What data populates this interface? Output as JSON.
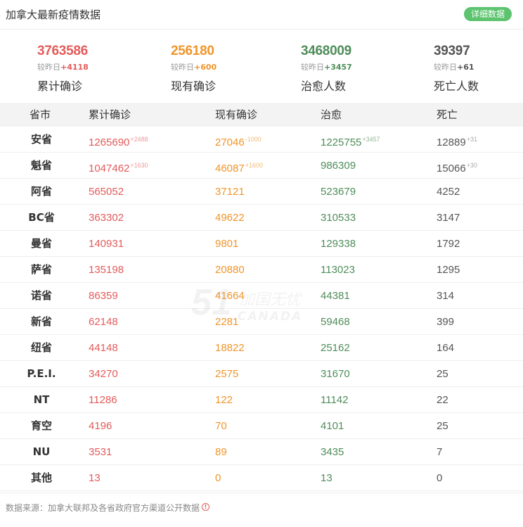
{
  "header": {
    "title": "加拿大最新疫情数据",
    "detail_button": "详细数据"
  },
  "summary": [
    {
      "value": "3763586",
      "delta_label": "较昨日",
      "delta": "+4118",
      "label": "累计确诊",
      "color": "#e45b5b"
    },
    {
      "value": "256180",
      "delta_label": "较昨日",
      "delta": "+600",
      "label": "现有确诊",
      "color": "#f0952a"
    },
    {
      "value": "3468009",
      "delta_label": "较昨日",
      "delta": "+3457",
      "label": "治愈人数",
      "color": "#4f8d5a"
    },
    {
      "value": "39397",
      "delta_label": "较昨日",
      "delta": "+61",
      "label": "死亡人数",
      "color": "#555555"
    }
  ],
  "table": {
    "headers": [
      "省市",
      "累计确诊",
      "现有确诊",
      "治愈",
      "死亡"
    ],
    "rows": [
      {
        "prov": "安省",
        "total": "1265690",
        "total_d": "+2488",
        "active": "27046",
        "active_d": "-1000",
        "cured": "1225755",
        "cured_d": "+3457",
        "dead": "12889",
        "dead_d": "+31"
      },
      {
        "prov": "魁省",
        "total": "1047462",
        "total_d": "+1630",
        "active": "46087",
        "active_d": "+1600",
        "cured": "986309",
        "cured_d": "",
        "dead": "15066",
        "dead_d": "+30"
      },
      {
        "prov": "阿省",
        "total": "565052",
        "total_d": "",
        "active": "37121",
        "active_d": "",
        "cured": "523679",
        "cured_d": "",
        "dead": "4252",
        "dead_d": ""
      },
      {
        "prov": "BC省",
        "total": "363302",
        "total_d": "",
        "active": "49622",
        "active_d": "",
        "cured": "310533",
        "cured_d": "",
        "dead": "3147",
        "dead_d": ""
      },
      {
        "prov": "曼省",
        "total": "140931",
        "total_d": "",
        "active": "9801",
        "active_d": "",
        "cured": "129338",
        "cured_d": "",
        "dead": "1792",
        "dead_d": ""
      },
      {
        "prov": "萨省",
        "total": "135198",
        "total_d": "",
        "active": "20880",
        "active_d": "",
        "cured": "113023",
        "cured_d": "",
        "dead": "1295",
        "dead_d": ""
      },
      {
        "prov": "诺省",
        "total": "86359",
        "total_d": "",
        "active": "41664",
        "active_d": "",
        "cured": "44381",
        "cured_d": "",
        "dead": "314",
        "dead_d": ""
      },
      {
        "prov": "新省",
        "total": "62148",
        "total_d": "",
        "active": "2281",
        "active_d": "",
        "cured": "59468",
        "cured_d": "",
        "dead": "399",
        "dead_d": ""
      },
      {
        "prov": "纽省",
        "total": "44148",
        "total_d": "",
        "active": "18822",
        "active_d": "",
        "cured": "25162",
        "cured_d": "",
        "dead": "164",
        "dead_d": ""
      },
      {
        "prov": "P.E.I.",
        "total": "34270",
        "total_d": "",
        "active": "2575",
        "active_d": "",
        "cured": "31670",
        "cured_d": "",
        "dead": "25",
        "dead_d": ""
      },
      {
        "prov": "NT",
        "total": "11286",
        "total_d": "",
        "active": "122",
        "active_d": "",
        "cured": "11142",
        "cured_d": "",
        "dead": "22",
        "dead_d": ""
      },
      {
        "prov": "育空",
        "total": "4196",
        "total_d": "",
        "active": "70",
        "active_d": "",
        "cured": "4101",
        "cured_d": "",
        "dead": "25",
        "dead_d": ""
      },
      {
        "prov": "NU",
        "total": "3531",
        "total_d": "",
        "active": "89",
        "active_d": "",
        "cured": "3435",
        "cured_d": "",
        "dead": "7",
        "dead_d": ""
      },
      {
        "prov": "其他",
        "total": "13",
        "total_d": "",
        "active": "0",
        "active_d": "",
        "cured": "13",
        "cured_d": "",
        "dead": "0",
        "dead_d": ""
      }
    ]
  },
  "watermark": {
    "big": "51",
    "cn": "加国无忧",
    "en": "CANADA"
  },
  "footer": {
    "source": "数据来源：加拿大联邦及各省政府官方渠道公开数据",
    "icon": "info-icon",
    "icon_glyph": "!"
  }
}
